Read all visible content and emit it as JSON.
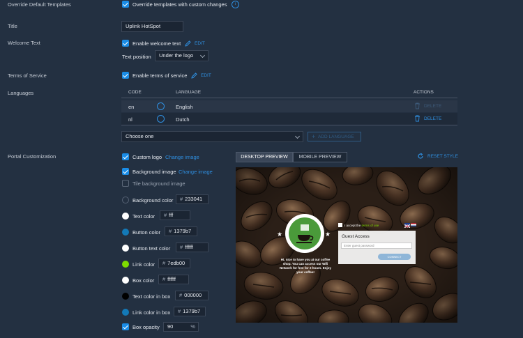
{
  "sections": {
    "override": "Override Default Templates",
    "title": "Title",
    "welcome": "Welcome Text",
    "terms": "Terms of Service",
    "languages": "Languages",
    "portal": "Portal Customization"
  },
  "override": {
    "checkbox_label": "Override templates with custom changes",
    "info": "i"
  },
  "title_field": {
    "value": "Uplink HotSpot"
  },
  "welcome": {
    "checkbox_label": "Enable welcome text",
    "edit": "EDIT",
    "position_label": "Text position",
    "position_value": "Under the logo"
  },
  "terms": {
    "checkbox_label": "Enable terms of service",
    "edit": "EDIT"
  },
  "lang_table": {
    "headers": {
      "code": "CODE",
      "language": "LANGUAGE",
      "actions": "ACTIONS"
    },
    "rows": [
      {
        "code": "en",
        "language": "English",
        "action": "DELETE"
      },
      {
        "code": "nl",
        "language": "Dutch",
        "action": "DELETE"
      }
    ],
    "choose": "Choose one",
    "add": "ADD LANGUAGE"
  },
  "portal": {
    "custom_logo": "Custom logo",
    "change_image": "Change image",
    "background_image": "Background image",
    "change_image2": "Change image",
    "tile_bg": "Tile background image",
    "colors": [
      {
        "label": "Background color",
        "value": "233041",
        "swatch": "#233041"
      },
      {
        "label": "Text color",
        "value": "fff",
        "swatch": "#ffffff"
      },
      {
        "label": "Button color",
        "value": "1379b7",
        "swatch": "#1379b7"
      },
      {
        "label": "Button text color",
        "value": "ffffff",
        "swatch": "#ffffff"
      },
      {
        "label": "Link color",
        "value": "7edb00",
        "swatch": "#7edb00"
      },
      {
        "label": "Box color",
        "value": "ffffff",
        "swatch": "#ffffff"
      },
      {
        "label": "Text color in box",
        "value": "000000",
        "swatch": "#000000"
      },
      {
        "label": "Link color in box",
        "value": "1379b7",
        "swatch": "#1379b7"
      }
    ],
    "hash": "#",
    "box_opacity": {
      "label": "Box opacity",
      "value": "90",
      "unit": "%"
    }
  },
  "preview": {
    "tab_desktop": "DESKTOP PREVIEW",
    "tab_mobile": "MOBILE PREVIEW",
    "reset": "RESET STYLE",
    "welcome_text": "Hi, nice to have you at our coffee shop. You can access our Wifi Network for free for 2 hours. Enjoy your coffee!",
    "accept_text": "I accept the",
    "terms_link": "terms of use",
    "guest_access": "Guest Access",
    "password_placeholder": "Enter guest password",
    "connect": "CONNECT"
  }
}
